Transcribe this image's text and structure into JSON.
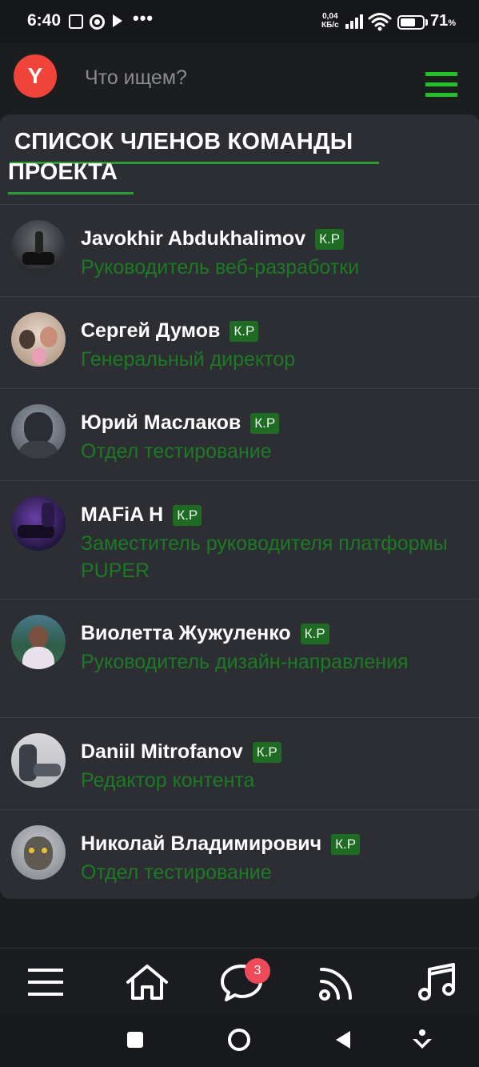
{
  "status_bar": {
    "time": "6:40",
    "net_speed_value": "0,04",
    "net_speed_unit": "КБ/с",
    "battery_percent": "71",
    "battery_unit": "%",
    "battery_level": 0.71,
    "icons": [
      "screen-record-icon",
      "chrome-icon",
      "play-icon",
      "more-dots-icon",
      "signal-icon",
      "wifi-icon",
      "battery-icon"
    ]
  },
  "header": {
    "logo_letter": "Y",
    "search_placeholder": "Что ищем?",
    "menu_icon": "hamburger-menu-icon",
    "accent_color": "#22c02a",
    "logo_color": "#f0443a"
  },
  "section": {
    "title_line1": "СПИСОК ЧЛЕНОВ КОМАНДЫ",
    "title_line2": "ПРОЕКТА"
  },
  "members": [
    {
      "name": "Javokhir Abdukhalimov",
      "badge": "К.Р",
      "role": "Руководитель веб-разработки"
    },
    {
      "name": "Сергей Думов",
      "badge": "К.Р",
      "role": "Генеральный директор"
    },
    {
      "name": "Юрий Маслаков",
      "badge": "К.Р",
      "role": "Отдел тестирование"
    },
    {
      "name": "MAFiA H",
      "badge": "К.Р",
      "role": "Заместитель руководителя платформы PUPER"
    },
    {
      "name": "Виолетта Жужуленко",
      "badge": "К.Р",
      "role": "Руководитель дизайн-направления"
    },
    {
      "name": "Daniil Mitrofanov",
      "badge": "К.Р",
      "role": "Редактор контента"
    },
    {
      "name": "Николай Владимирович",
      "badge": "К.Р",
      "role": "Отдел тестирование"
    }
  ],
  "bottom_nav": {
    "items": [
      "menu-icon",
      "home-icon",
      "chat-icon",
      "feed-icon",
      "music-icon"
    ],
    "chat_badge": "3"
  },
  "system_nav": {
    "items": [
      "recent-apps-button",
      "home-button",
      "back-button",
      "assist-button"
    ]
  }
}
